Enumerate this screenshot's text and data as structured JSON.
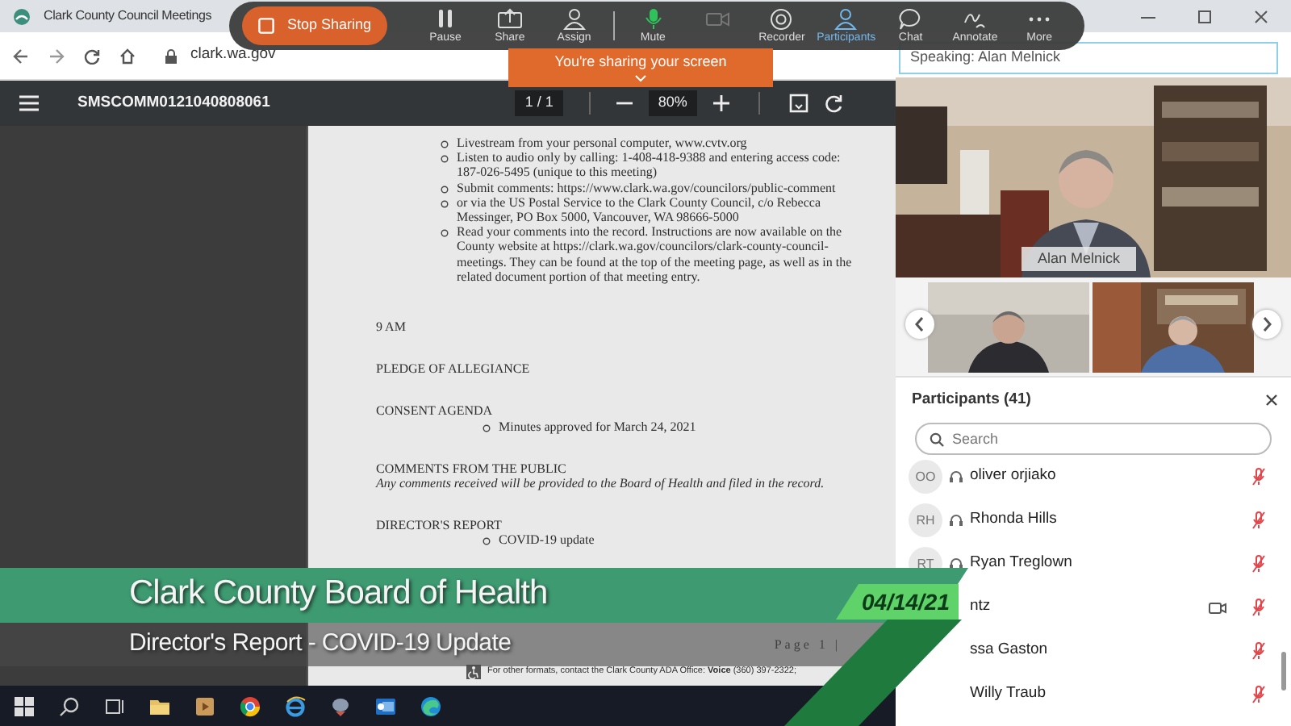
{
  "browser": {
    "tab_title": "Clark County Council Meetings",
    "url": "clark.wa.gov"
  },
  "pdf_viewer": {
    "file_name": "SMSCOMM0121040808061",
    "page": "1 / 1",
    "zoom": "80%",
    "document": {
      "bullets": [
        "Livestream from your personal computer, www.cvtv.org",
        "Listen to audio only by calling: 1-408-418-9388 and entering access code: 187-026-5495 (unique to this meeting)",
        "Submit comments: https://www.clark.wa.gov/councilors/public-comment",
        "or via the US Postal Service to the Clark County Council, c/o Rebecca Messinger, PO Box 5000, Vancouver, WA 98666-5000",
        "Read your comments into the record. Instructions are now available on the County website at https://clark.wa.gov/councilors/clark-county-council-meetings. They can be found at the top of the meeting page, as well as in the related document portion of that meeting entry."
      ],
      "sections": [
        {
          "heading": "9 AM"
        },
        {
          "heading": "PLEDGE OF ALLEGIANCE"
        },
        {
          "heading": "CONSENT AGENDA",
          "items": [
            "Minutes approved for March 24, 2021"
          ]
        },
        {
          "heading": "COMMENTS FROM THE PUBLIC",
          "note": "Any comments received will be provided to the Board of Health and filed in the record."
        },
        {
          "heading": "DIRECTOR'S REPORT",
          "items": [
            "COVID-19 update"
          ]
        }
      ],
      "page_footer": "Page 1 |",
      "ada_note": "For other formats, contact the Clark County ADA Office: **Voice** (360) 397-2322;"
    }
  },
  "sharing_toolbar": {
    "stop_label": "Stop Sharing",
    "banner": "You're sharing your screen",
    "items": [
      {
        "kind": "pause",
        "label": "Pause",
        "selected": false
      },
      {
        "kind": "share",
        "label": "Share",
        "selected": false
      },
      {
        "kind": "assign",
        "label": "Assign",
        "selected": false
      },
      {
        "kind": "mute",
        "label": "Mute",
        "selected": false
      },
      {
        "kind": "video",
        "selected": false
      },
      {
        "kind": "recorder",
        "label": "Recorder",
        "selected": false
      },
      {
        "kind": "participants",
        "label": "Participants",
        "selected": true
      },
      {
        "kind": "chat",
        "label": "Chat",
        "selected": false
      },
      {
        "kind": "annotate",
        "label": "Annotate",
        "selected": false
      },
      {
        "kind": "more",
        "label": "More",
        "selected": false
      }
    ]
  },
  "meeting": {
    "speaking": "Speaking: Alan Melnick",
    "speaker_name": "Alan Melnick",
    "participants": {
      "title": "Participants (41)",
      "search_placeholder": "Search",
      "people": [
        {
          "initials": "OO",
          "name": "oliver orjiako",
          "video": false,
          "muted": true
        },
        {
          "initials": "RH",
          "name": "Rhonda Hills",
          "video": false,
          "muted": true
        },
        {
          "initials": "RT",
          "name": "Ryan Treglown",
          "video": false,
          "muted": true
        },
        {
          "name": "ntz",
          "video": true,
          "muted": true
        },
        {
          "name": "ssa Gaston",
          "video": false,
          "muted": true
        },
        {
          "name": "Willy Traub",
          "video": false,
          "muted": true
        }
      ]
    }
  },
  "lower_third": {
    "title": "Clark County Board of Health",
    "subtitle": "Director's Report - COVID-19 Update",
    "date": "04/14/21"
  },
  "taskbar": {
    "apps": [
      {
        "kind": "start"
      },
      {
        "kind": "search"
      },
      {
        "kind": "task_view"
      },
      {
        "kind": "folder"
      },
      {
        "kind": "media"
      },
      {
        "kind": "browser_round"
      },
      {
        "kind": "browser_e"
      },
      {
        "kind": "app"
      },
      {
        "kind": "mail"
      },
      {
        "kind": "browser_wave"
      }
    ]
  }
}
